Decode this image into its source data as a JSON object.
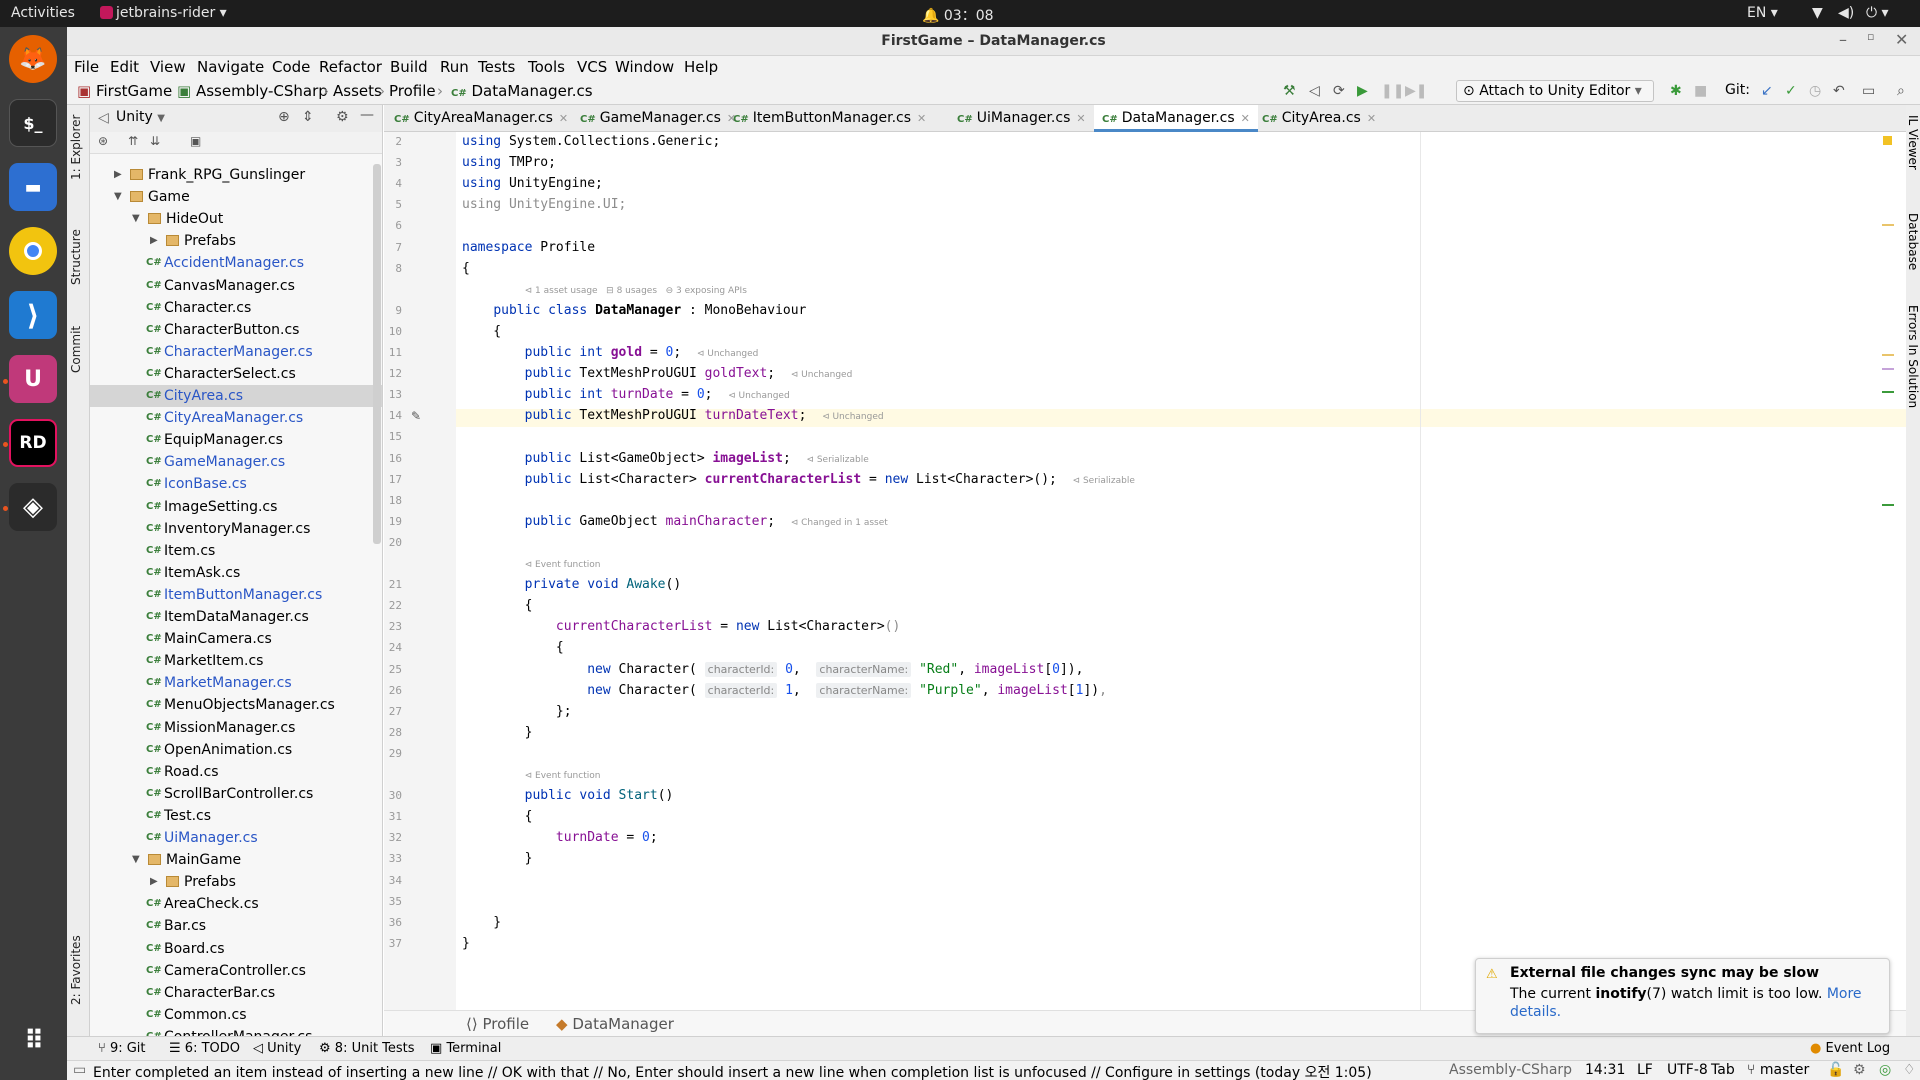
{
  "system": {
    "activities": "Activities",
    "app_menu": "jetbrains-rider",
    "clock": "03：08",
    "lang": "EN"
  },
  "window": {
    "title": "FirstGame – DataManager.cs"
  },
  "menu": [
    "File",
    "Edit",
    "View",
    "Navigate",
    "Code",
    "Refactor",
    "Build",
    "Run",
    "Tests",
    "Tools",
    "VCS",
    "Window",
    "Help"
  ],
  "breadcrumb": [
    "FirstGame",
    "Assembly-CSharp",
    "Assets",
    "Profile",
    "DataManager.cs"
  ],
  "toolbar": {
    "attach": "Attach to Unity Editor",
    "git": "Git:"
  },
  "left_strip": {
    "explorer": "1: Explorer",
    "structure": "Structure",
    "commit": "Commit",
    "favorites": "2: Favorites"
  },
  "explorer": {
    "title": "Unity",
    "tree": [
      {
        "name": "Frank_RPG_Gunslinger",
        "type": "folder",
        "level": 0,
        "state": "collapsed"
      },
      {
        "name": "Game",
        "type": "folder",
        "level": 0,
        "state": "expanded"
      },
      {
        "name": "HideOut",
        "type": "folder",
        "level": 1,
        "state": "expanded"
      },
      {
        "name": "Prefabs",
        "type": "folder",
        "level": 2,
        "state": "collapsed"
      },
      {
        "name": "AccidentManager.cs",
        "type": "cs",
        "level": 2,
        "vcs": "modified"
      },
      {
        "name": "CanvasManager.cs",
        "type": "cs",
        "level": 2,
        "vcs": "none"
      },
      {
        "name": "Character.cs",
        "type": "cs",
        "level": 2,
        "vcs": "none"
      },
      {
        "name": "CharacterButton.cs",
        "type": "cs",
        "level": 2,
        "vcs": "none"
      },
      {
        "name": "CharacterManager.cs",
        "type": "cs",
        "level": 2,
        "vcs": "modified"
      },
      {
        "name": "CharacterSelect.cs",
        "type": "cs",
        "level": 2,
        "vcs": "none"
      },
      {
        "name": "CityArea.cs",
        "type": "cs",
        "level": 2,
        "vcs": "modified",
        "selected": true
      },
      {
        "name": "CityAreaManager.cs",
        "type": "cs",
        "level": 2,
        "vcs": "modified"
      },
      {
        "name": "EquipManager.cs",
        "type": "cs",
        "level": 2,
        "vcs": "none"
      },
      {
        "name": "GameManager.cs",
        "type": "cs",
        "level": 2,
        "vcs": "modified"
      },
      {
        "name": "IconBase.cs",
        "type": "cs",
        "level": 2,
        "vcs": "modified"
      },
      {
        "name": "ImageSetting.cs",
        "type": "cs",
        "level": 2,
        "vcs": "none"
      },
      {
        "name": "InventoryManager.cs",
        "type": "cs",
        "level": 2,
        "vcs": "none"
      },
      {
        "name": "Item.cs",
        "type": "cs",
        "level": 2,
        "vcs": "none"
      },
      {
        "name": "ItemAsk.cs",
        "type": "cs",
        "level": 2,
        "vcs": "none"
      },
      {
        "name": "ItemButtonManager.cs",
        "type": "cs",
        "level": 2,
        "vcs": "modified"
      },
      {
        "name": "ItemDataManager.cs",
        "type": "cs",
        "level": 2,
        "vcs": "none"
      },
      {
        "name": "MainCamera.cs",
        "type": "cs",
        "level": 2,
        "vcs": "none"
      },
      {
        "name": "MarketItem.cs",
        "type": "cs",
        "level": 2,
        "vcs": "none"
      },
      {
        "name": "MarketManager.cs",
        "type": "cs",
        "level": 2,
        "vcs": "modified"
      },
      {
        "name": "MenuObjectsManager.cs",
        "type": "cs",
        "level": 2,
        "vcs": "none"
      },
      {
        "name": "MissionManager.cs",
        "type": "cs",
        "level": 2,
        "vcs": "none"
      },
      {
        "name": "OpenAnimation.cs",
        "type": "cs",
        "level": 2,
        "vcs": "none"
      },
      {
        "name": "Road.cs",
        "type": "cs",
        "level": 2,
        "vcs": "none"
      },
      {
        "name": "ScrollBarController.cs",
        "type": "cs",
        "level": 2,
        "vcs": "none"
      },
      {
        "name": "Test.cs",
        "type": "cs",
        "level": 2,
        "vcs": "none"
      },
      {
        "name": "UiManager.cs",
        "type": "cs",
        "level": 2,
        "vcs": "modified"
      },
      {
        "name": "MainGame",
        "type": "folder",
        "level": 1,
        "state": "expanded"
      },
      {
        "name": "Prefabs",
        "type": "folder",
        "level": 2,
        "state": "collapsed"
      },
      {
        "name": "AreaCheck.cs",
        "type": "cs",
        "level": 2,
        "vcs": "none"
      },
      {
        "name": "Bar.cs",
        "type": "cs",
        "level": 2,
        "vcs": "none"
      },
      {
        "name": "Board.cs",
        "type": "cs",
        "level": 2,
        "vcs": "none"
      },
      {
        "name": "CameraController.cs",
        "type": "cs",
        "level": 2,
        "vcs": "none"
      },
      {
        "name": "CharacterBar.cs",
        "type": "cs",
        "level": 2,
        "vcs": "none"
      },
      {
        "name": "Common.cs",
        "type": "cs",
        "level": 2,
        "vcs": "none"
      },
      {
        "name": "ControllerManager.cs",
        "type": "cs",
        "level": 2,
        "vcs": "none"
      }
    ]
  },
  "tabs": [
    {
      "label": "CityAreaManager.cs",
      "active": false
    },
    {
      "label": "GameManager.cs",
      "active": false
    },
    {
      "label": "ItemButtonManager.cs",
      "active": false
    },
    {
      "label": "UiManager.cs",
      "active": false
    },
    {
      "label": "DataManager.cs",
      "active": true
    },
    {
      "label": "CityArea.cs",
      "active": false
    }
  ],
  "editor": {
    "lines": [
      {
        "n": "2",
        "code": "<span class='kw'>using</span> System.Collections.Generic;"
      },
      {
        "n": "3",
        "code": "<span class='kw'>using</span> TMPro;"
      },
      {
        "n": "4",
        "code": "<span class='kw'>using</span> UnityEngine;"
      },
      {
        "n": "5",
        "code": "<span class='gr'>using UnityEngine.UI;</span>"
      },
      {
        "n": "6",
        "code": ""
      },
      {
        "n": "7",
        "code": "<span class='kw'>namespace</span> Profile"
      },
      {
        "n": "8",
        "code": "{"
      },
      {
        "n": "",
        "code": "        <span class='hint'>⊲ 1 asset usage   ⊟ 8 usages   ⊖ 3 exposing APIs</span>"
      },
      {
        "n": "9",
        "code": "    <span class='kw'>public class</span> <b>DataManager</b> : MonoBehaviour"
      },
      {
        "n": "10",
        "code": "    {"
      },
      {
        "n": "11",
        "code": "        <span class='kw'>public int</span> <b class='fd'>gold</b> = <span class='num'>0</span>;  <span class='hint'>⊲ Unchanged</span>"
      },
      {
        "n": "12",
        "code": "        <span class='kw'>public</span> TextMeshProUGUI <span class='fd'>goldText</span>;  <span class='hint'>⊲ Unchanged</span>"
      },
      {
        "n": "13",
        "code": "        <span class='kw'>public int</span> <span class='fd'>turnDate</span> = <span class='num'>0</span>;  <span class='hint'>⊲ Unchanged</span>"
      },
      {
        "n": "14",
        "code": "        <span class='kw'>public</span> TextMeshProUGUI <span class='fd'>turnDateText</span>;  <span class='hint'>⊲ Unchanged</span>"
      },
      {
        "n": "15",
        "code": ""
      },
      {
        "n": "16",
        "code": "        <span class='kw'>public</span> List&lt;GameObject&gt; <b class='fd'>imageList</b>;  <span class='hint'>⊲ Serializable</span>"
      },
      {
        "n": "17",
        "code": "        <span class='kw'>public</span> List&lt;Character&gt; <b class='fd'>currentCharacterList</b> = <span class='kw'>new</span> List&lt;Character&gt;();  <span class='hint'>⊲ Serializable</span>"
      },
      {
        "n": "18",
        "code": ""
      },
      {
        "n": "19",
        "code": "        <span class='kw'>public</span> GameObject <span class='fd'>mainCharacter</span>;  <span class='hint'>⊲ Changed in 1 asset</span>"
      },
      {
        "n": "20",
        "code": ""
      },
      {
        "n": "",
        "code": "        <span class='hint'>⊲ Event function</span>"
      },
      {
        "n": "21",
        "code": "        <span class='kw'>private void</span> <span class='mt'>Awake</span>()"
      },
      {
        "n": "22",
        "code": "        {"
      },
      {
        "n": "23",
        "code": "            <span class='fd'>currentCharacterList</span> = <span class='kw'>new</span> List&lt;Character&gt;<span class='gr'>()</span>"
      },
      {
        "n": "24",
        "code": "            {"
      },
      {
        "n": "25",
        "code": "                <span class='kw'>new</span> Character( <span class='ph'>characterId:</span> <span class='num'>0</span>,  <span class='ph'>characterName:</span> <span class='str'>\"Red\"</span>, <span class='fd'>imageList</span>[<span class='num'>0</span>]),"
      },
      {
        "n": "26",
        "code": "                <span class='kw'>new</span> Character( <span class='ph'>characterId:</span> <span class='num'>1</span>,  <span class='ph'>characterName:</span> <span class='str'>\"Purple\"</span>, <span class='fd'>imageList</span>[<span class='num'>1</span>])<span class='gr'>,</span>"
      },
      {
        "n": "27",
        "code": "            };"
      },
      {
        "n": "28",
        "code": "        }"
      },
      {
        "n": "29",
        "code": ""
      },
      {
        "n": "",
        "code": "        <span class='hint'>⊲ Event function</span>"
      },
      {
        "n": "30",
        "code": "        <span class='kw'>public void</span> <span class='mt'>Start</span>()"
      },
      {
        "n": "31",
        "code": "        {"
      },
      {
        "n": "32",
        "code": "            <span class='fd'>turnDate</span> = <span class='num'>0</span>;"
      },
      {
        "n": "33",
        "code": "        }"
      },
      {
        "n": "34",
        "code": ""
      },
      {
        "n": "35",
        "code": ""
      },
      {
        "n": "36",
        "code": "    }"
      },
      {
        "n": "37",
        "code": "}"
      }
    ]
  },
  "editor_breadcrumb": {
    "ns": "Profile",
    "cls": "DataManager"
  },
  "right_strip": [
    "IL Viewer",
    "Database",
    "Errors In Solution"
  ],
  "bottom_tools": {
    "git": "9: Git",
    "todo": "6: TODO",
    "unity": "Unity",
    "unit_tests": "8: Unit Tests",
    "terminal": "Terminal",
    "event_log": "Event Log"
  },
  "status": {
    "message": "Enter completed an item instead of inserting a new line // OK with that // No, Enter should insert a new line when completion list is unfocused // Configure in settings (today 오전 1:05)",
    "context": "Assembly-CSharp",
    "position": "14:31",
    "line_sep": "LF",
    "encoding": "UTF-8",
    "indent": "Tab",
    "branch": "master"
  },
  "notification": {
    "title": "External file changes sync may be slow",
    "body_pre": "The current ",
    "body_bold": "inotify",
    "body_post": "(7) watch limit is too low. ",
    "link": "More details."
  },
  "colors": {
    "accent": "#4a88c7",
    "modified_file": "#2a56c6",
    "ubuntu_orange": "#e95420"
  }
}
